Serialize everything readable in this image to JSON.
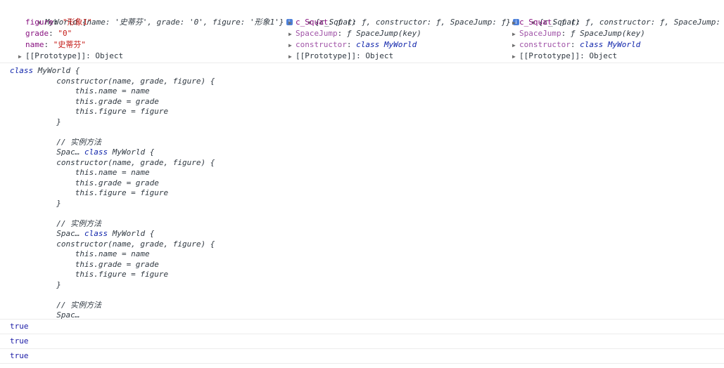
{
  "object_row": {
    "col1": {
      "summary_class": "MyWorld",
      "summary_rest": "{name: '史蒂芬', grade: '0', figure: '形象1'}",
      "props": [
        {
          "key": "figure",
          "value": "\"形象1\""
        },
        {
          "key": "grade",
          "value": "\"0\""
        },
        {
          "key": "name",
          "value": "\"史蒂芬\""
        }
      ],
      "prototype": "[[Prototype]]: Object"
    },
    "col2": {
      "summary": "{c_Squat: ƒ, constructor: ƒ, SpaceJump: ƒ}",
      "c_squat_key": "c_Squat",
      "c_squat_val": "ƒ ()",
      "spacejump_key": "SpaceJump",
      "spacejump_val": "ƒ SpaceJump(key)",
      "constructor_key": "constructor",
      "constructor_val": "class MyWorld",
      "prototype": "[[Prototype]]: Object"
    },
    "col3": {
      "summary": "{c_Squat: ƒ, constructor: ƒ, SpaceJump: ƒ}",
      "c_squat_key": "c_Squat",
      "c_squat_val": "ƒ ()",
      "spacejump_key": "SpaceJump",
      "spacejump_val": "ƒ SpaceJump(key)",
      "constructor_key": "constructor",
      "constructor_val": "class MyWorld",
      "prototype": "[[Prototype]]: Object"
    }
  },
  "code_lines": [
    "class MyWorld {",
    "          constructor(name, grade, figure) {",
    "              this.name = name",
    "              this.grade = grade",
    "              this.figure = figure",
    "          }",
    "",
    "          // 实例方法",
    "          Spac… class MyWorld {",
    "          constructor(name, grade, figure) {",
    "              this.name = name",
    "              this.grade = grade",
    "              this.figure = figure",
    "          }",
    "",
    "          // 实例方法",
    "          Spac… class MyWorld {",
    "          constructor(name, grade, figure) {",
    "              this.name = name",
    "              this.grade = grade",
    "              this.figure = figure",
    "          }",
    "",
    "          // 实例方法",
    "          Spac…"
  ],
  "results": [
    "true",
    "true",
    "true"
  ],
  "icons": {
    "expanded": "triangle-down-icon",
    "collapsed": "triangle-right-icon",
    "info": "info-icon"
  }
}
